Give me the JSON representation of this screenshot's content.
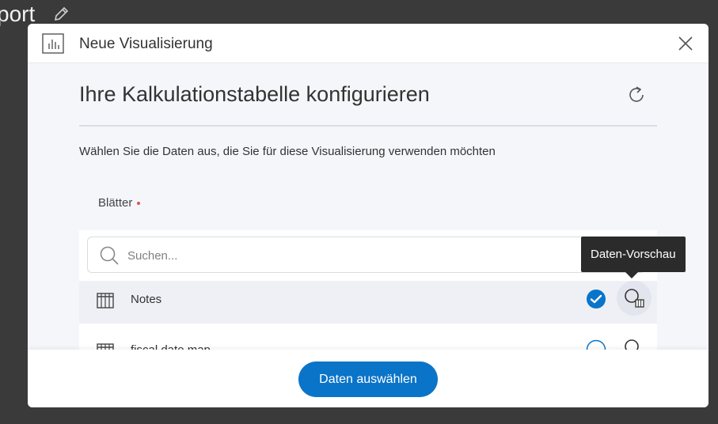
{
  "background": {
    "title": "port"
  },
  "dialog": {
    "title": "Neue Visualisierung",
    "config_title": "Ihre Kalkulationstabelle konfigurieren",
    "description": "Wählen Sie die Daten aus, die Sie für diese Visualisierung verwenden möchten",
    "sheets_label": "Blätter",
    "search": {
      "placeholder": "Suchen...",
      "value": ""
    },
    "sheets": [
      {
        "label": "Notes",
        "selected": true
      },
      {
        "label": "fiscal date map",
        "selected": false
      }
    ],
    "tooltip": "Daten-Vorschau",
    "primary_button": "Daten auswählen"
  },
  "colors": {
    "accent": "#0a74c9",
    "required": "#e05050",
    "tooltip_bg": "#2b2b2b",
    "overlay": "#3a3a3a"
  },
  "icons": {
    "header": "bar-chart-icon",
    "close": "close-icon",
    "refresh": "refresh-icon",
    "search": "search-icon",
    "sheet": "table-icon",
    "check": "check-circle-icon",
    "preview": "data-preview-icon",
    "edit": "pencil-icon"
  }
}
